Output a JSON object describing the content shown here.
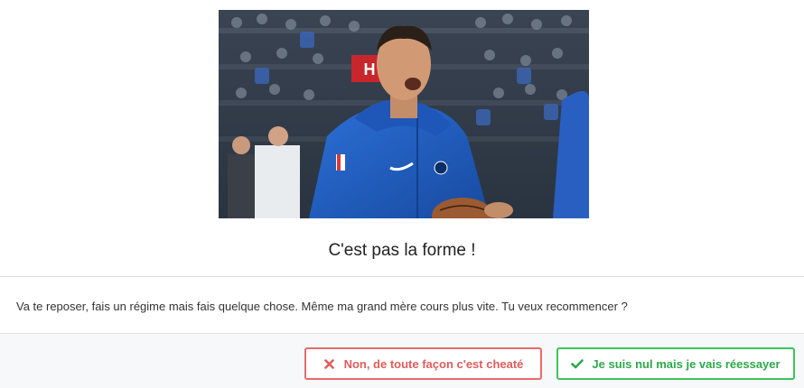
{
  "modal": {
    "title": "C'est pas la forme !",
    "message": "Va te reposer, fais un régime mais fais quelque chose. Même ma grand mère cours plus vite. Tu veux recommencer ?",
    "image": {
      "subject": "basketball-player-reaction-gif",
      "sign_text": "H"
    },
    "buttons": {
      "cancel": {
        "label": "Non, de toute façon c'est cheaté",
        "icon": "close-icon",
        "color": "#e05c5c"
      },
      "retry": {
        "label": "Je suis nul mais je vais réessayer",
        "icon": "check-icon",
        "color": "#2ea84a"
      }
    }
  }
}
